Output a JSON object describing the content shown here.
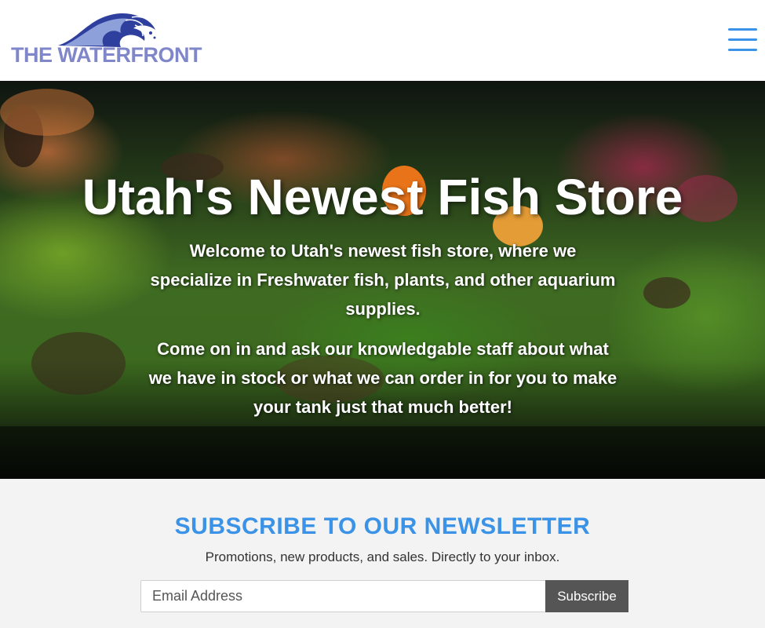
{
  "header": {
    "logo_text": "THE WATERFRONT",
    "menu_icon": "hamburger-menu-icon"
  },
  "hero": {
    "title": "Utah's Newest Fish Store",
    "paragraph_1": "Welcome to Utah's newest fish store, where we specialize in Freshwater fish, plants, and other aquarium supplies.",
    "paragraph_2": "Come on in and ask our knowledgable staff about what we have in stock or what we can order in for you to make your tank just that much better!"
  },
  "newsletter": {
    "title": "SUBSCRIBE TO OUR NEWSLETTER",
    "subtitle": "Promotions, new products, and sales. Directly to your inbox.",
    "email_placeholder": "Email Address",
    "button_label": "Subscribe"
  },
  "colors": {
    "accent_blue": "#3a93e6",
    "logo_purple": "#7f86c9",
    "button_gray": "#555555",
    "newsletter_bg": "#f3f3f3"
  }
}
